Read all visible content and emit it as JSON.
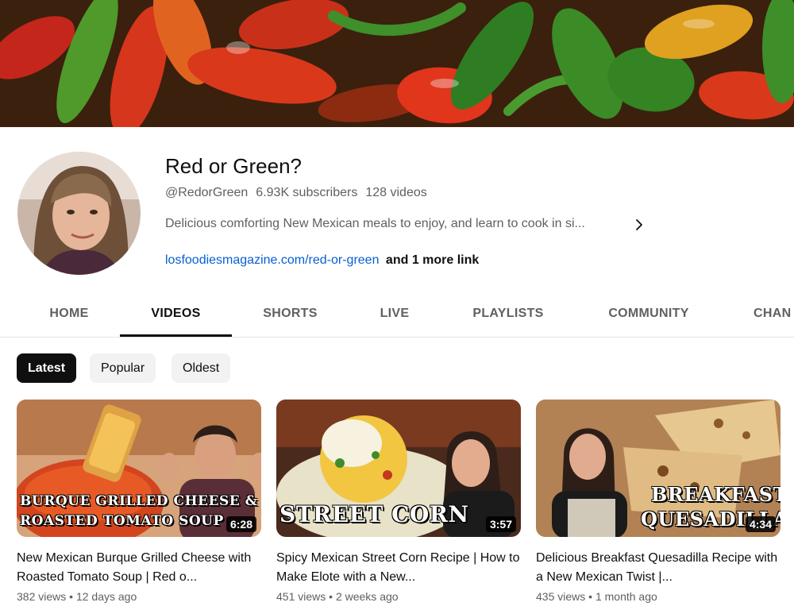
{
  "channel": {
    "name": "Red or Green?",
    "handle": "@RedorGreen",
    "subscribers": "6.93K subscribers",
    "video_count": "128 videos",
    "description": "Delicious comforting New Mexican meals to enjoy, and learn to cook in si...",
    "link": "losfoodiesmagazine.com/red-or-green",
    "more_links": "and 1 more link"
  },
  "tabs": [
    {
      "label": "HOME"
    },
    {
      "label": "VIDEOS"
    },
    {
      "label": "SHORTS"
    },
    {
      "label": "LIVE"
    },
    {
      "label": "PLAYLISTS"
    },
    {
      "label": "COMMUNITY"
    },
    {
      "label": "CHAN"
    }
  ],
  "active_tab": "VIDEOS",
  "filters": [
    {
      "label": "Latest"
    },
    {
      "label": "Popular"
    },
    {
      "label": "Oldest"
    }
  ],
  "videos": [
    {
      "overlay_line1": "BURQUE GRILLED CHEESE &",
      "overlay_line2": "ROASTED TOMATO SOUP",
      "duration": "6:28",
      "title": "New Mexican Burque Grilled Cheese with Roasted Tomato Soup | Red o...",
      "views": "382 views",
      "age": "12 days ago"
    },
    {
      "overlay_line1": "STREET CORN",
      "overlay_line2": "",
      "duration": "3:57",
      "title": "Spicy Mexican Street Corn Recipe | How to Make Elote with a New...",
      "views": "451 views",
      "age": "2 weeks ago"
    },
    {
      "overlay_line1": "BREAKFAST",
      "overlay_line2": "QUESADILLA",
      "duration": "4:34",
      "title": "Delicious Breakfast Quesadilla Recipe with a New Mexican Twist |...",
      "views": "435 views",
      "age": "1 month ago"
    }
  ],
  "separator": "•",
  "icons": {
    "description_expand": "chevron-right-icon"
  },
  "colors": {
    "link": "#065fd4",
    "text_primary": "#0f0f0f",
    "text_secondary": "#606060",
    "chip_active_bg": "#0f0f0f",
    "chip_bg": "#f2f2f2"
  }
}
